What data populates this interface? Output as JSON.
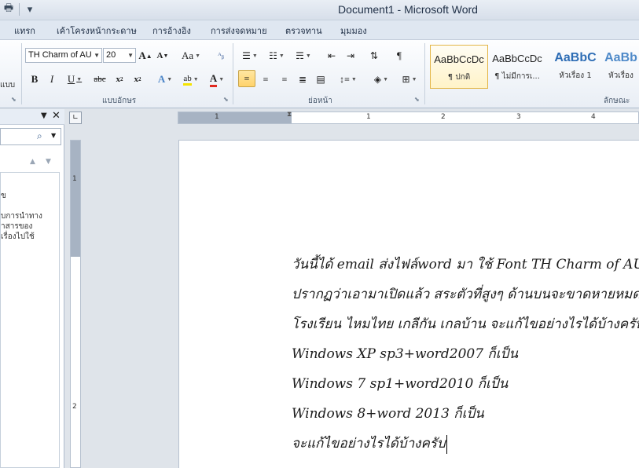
{
  "window": {
    "title": "Document1 - Microsoft Word"
  },
  "ribbon_tabs": [
    "แทรก",
    "เค้าโครงหน้ากระดาษ",
    "การอ้างอิง",
    "การส่งจดหมาย",
    "ตรวจทาน",
    "มุมมอง"
  ],
  "font": {
    "name": "TH Charm of AU",
    "size": "20"
  },
  "groups": {
    "font_label": "แบบอักษร",
    "paragraph_label": "ย่อหน้า",
    "styles_label": "ลักษณะ",
    "clipboard_cut": "แบบ"
  },
  "styles": [
    {
      "sample": "AaBbCcDc",
      "name": "¶ ปกติ"
    },
    {
      "sample": "AaBbCcDc",
      "name": "¶ ไม่มีการเ..."
    },
    {
      "sample": "AaBbC",
      "name": "หัวเรื่อง 1"
    },
    {
      "sample": "AaBb",
      "name": "หัวเรื่อง"
    }
  ],
  "navpane": {
    "lines": [
      "ข",
      "บการนำทาง",
      "าสารของ",
      "เรื่องไปใช้"
    ]
  },
  "ruler": {
    "h_marks": [
      "1",
      "1",
      "2",
      "3",
      "4"
    ],
    "v_marks": [
      "1",
      "2"
    ]
  },
  "document": {
    "lines": [
      "วันนี้ได้ email ส่งไฟล์word มา ใช้ Font TH Charm of AU",
      "ปรากฏว่าเอามาเปิดแล้ว สระตัวที่สูงๆ ด้านบนจะขาดหายหมด เช่น",
      "โรงเรียน ไหมไทย เกลีกัน เกลบ้าน จะแก้ไขอย่างไรได้บ้างครับ",
      "Windows XP sp3+word2007 ก็เป็น",
      "Windows 7 sp1+word2010 ก็เป็น",
      "Windows 8+word 2013 ก็เป็น",
      "จะแก้ไขอย่างไรได้บ้างครับ"
    ]
  }
}
